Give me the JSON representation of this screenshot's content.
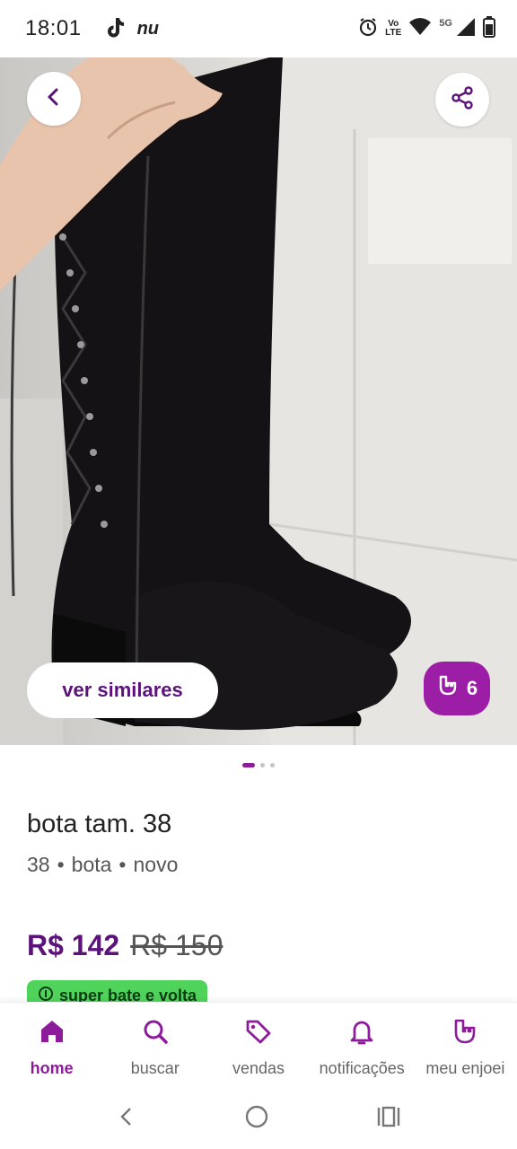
{
  "status_bar": {
    "time": "18:01",
    "carrier_badge": "nu",
    "volte_line1": "Vo",
    "volte_line2": "LTE",
    "network": "5G"
  },
  "hero": {
    "similar_button_label": "ver similares",
    "likes_count": "6",
    "carousel_total": 3,
    "carousel_active": 1
  },
  "product": {
    "title": "bota tam. 38",
    "size": "38",
    "category": "bota",
    "condition": "novo",
    "price": "R$ 142",
    "old_price": "R$ 150",
    "promo_tag": "super bate e volta"
  },
  "bottom_nav": {
    "items": [
      {
        "label": "home",
        "icon": "home-icon",
        "active": true
      },
      {
        "label": "buscar",
        "icon": "search-icon",
        "active": false
      },
      {
        "label": "vendas",
        "icon": "tag-icon",
        "active": false
      },
      {
        "label": "notificações",
        "icon": "bell-icon",
        "active": false
      },
      {
        "label": "meu enjoei",
        "icon": "rock-hand-icon",
        "active": false
      }
    ]
  },
  "colors": {
    "brand_purple": "#8c1c9a",
    "price_purple": "#5b1379",
    "promo_green": "#4fd35b"
  }
}
